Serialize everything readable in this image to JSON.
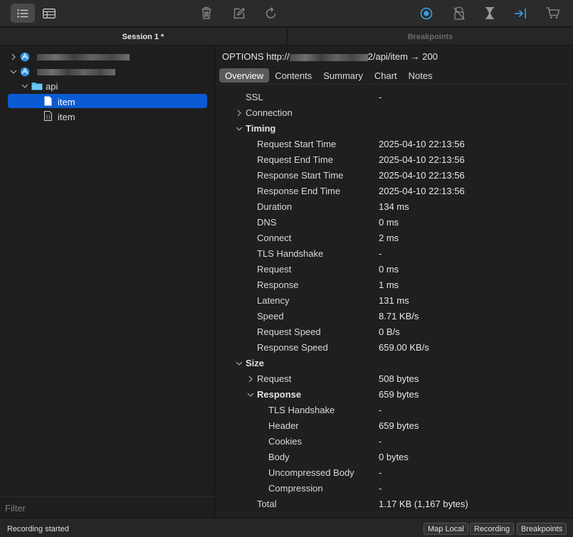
{
  "toolbar": {
    "icons": [
      "list-icon",
      "table-icon",
      "trash-icon",
      "compose-icon",
      "refresh-icon",
      "record-icon",
      "throttle-icon",
      "hourglass-icon",
      "breakpoint-arrow-icon",
      "cart-icon"
    ],
    "accent_color": "#3aa0e6"
  },
  "tabs": {
    "session": "Session 1 *",
    "breakpoints": "Breakpoints"
  },
  "tree": {
    "folder": "api",
    "items": [
      "item",
      "item"
    ]
  },
  "filter": {
    "placeholder": "Filter"
  },
  "request": {
    "method_prefix": "OPTIONS http://",
    "path": "2/api/item",
    "arrow": "→",
    "status": "200"
  },
  "subtabs": [
    "Overview",
    "Contents",
    "Summary",
    "Chart",
    "Notes"
  ],
  "overview": {
    "ssl": {
      "k": "SSL",
      "v": "-"
    },
    "connection": "Connection",
    "timing": {
      "label": "Timing",
      "rows": [
        {
          "k": "Request Start Time",
          "v": "2025-04-10 22:13:56"
        },
        {
          "k": "Request End Time",
          "v": "2025-04-10 22:13:56"
        },
        {
          "k": "Response Start Time",
          "v": "2025-04-10 22:13:56"
        },
        {
          "k": "Response End Time",
          "v": "2025-04-10 22:13:56"
        },
        {
          "k": "Duration",
          "v": "134 ms"
        },
        {
          "k": "DNS",
          "v": "0 ms"
        },
        {
          "k": "Connect",
          "v": "2 ms"
        },
        {
          "k": "TLS Handshake",
          "v": "-"
        },
        {
          "k": "Request",
          "v": "0 ms"
        },
        {
          "k": "Response",
          "v": "1 ms"
        },
        {
          "k": "Latency",
          "v": "131 ms"
        },
        {
          "k": "Speed",
          "v": "8.71 KB/s"
        },
        {
          "k": "Request Speed",
          "v": "0 B/s"
        },
        {
          "k": "Response Speed",
          "v": "659.00 KB/s"
        }
      ]
    },
    "size": {
      "label": "Size",
      "request": {
        "k": "Request",
        "v": "508 bytes"
      },
      "response": {
        "k": "Response",
        "v": "659 bytes"
      },
      "response_rows": [
        {
          "k": "TLS Handshake",
          "v": "-"
        },
        {
          "k": "Header",
          "v": "659 bytes"
        },
        {
          "k": "Cookies",
          "v": "-"
        },
        {
          "k": "Body",
          "v": "0 bytes"
        },
        {
          "k": "Uncompressed Body",
          "v": "-"
        },
        {
          "k": "Compression",
          "v": "-"
        }
      ],
      "total": {
        "k": "Total",
        "v": "1.17 KB (1,167 bytes)"
      }
    }
  },
  "status": {
    "text": "Recording started",
    "buttons": [
      "Map Local",
      "Recording",
      "Breakpoints"
    ]
  }
}
